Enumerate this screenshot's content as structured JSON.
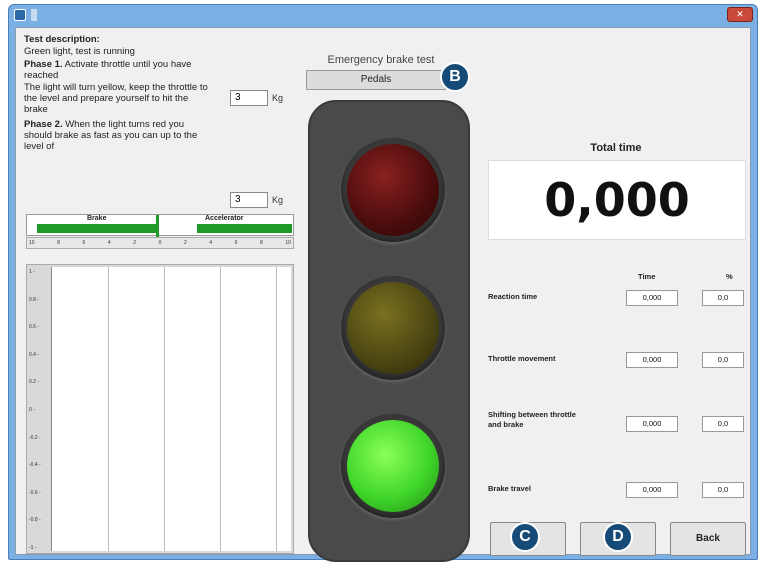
{
  "window": {
    "title": "",
    "close_glyph": "✕"
  },
  "description": {
    "heading": "Test description:",
    "status": "Green light, test is running",
    "phase1_title": "Phase 1.",
    "phase1_text": " Activate throttle until you have reached",
    "phase1_cont": "The light will turn yellow, keep the throttle to the level and prepare yourself to hit the brake",
    "phase1_value": "3",
    "phase2_title": "Phase 2.",
    "phase2_text": " When the light turns red you should brake as fast as you can up to the level of",
    "phase2_value": "3",
    "unit": "Kg"
  },
  "scale": {
    "brake_label": "Brake",
    "accel_label": "Accelerator",
    "brake_level": 0.47,
    "accel_level": 0.37,
    "ticks": [
      "10",
      "8",
      "6",
      "4",
      "2",
      "0",
      "2",
      "4",
      "6",
      "8",
      "10"
    ]
  },
  "chart": {
    "yticks": [
      "1",
      "0.8",
      "0.6",
      "0.4",
      "0.2",
      "0",
      "-0.2",
      "-0.4",
      "-0.6",
      "-0.8",
      "-1"
    ]
  },
  "center": {
    "emergency_label": "Emergency brake test",
    "pedals_button": "Pedals",
    "lights": {
      "red": "off",
      "yellow": "off",
      "green": "on"
    }
  },
  "results": {
    "total_label": "Total time",
    "total_value": "0,000",
    "col_time": "Time",
    "col_percent": "%",
    "rows": [
      {
        "label": "Reaction time",
        "time": "0,000",
        "percent": "0,0"
      },
      {
        "label": "Throttle movement",
        "time": "0,000",
        "percent": "0,0"
      },
      {
        "label": "Shifting between throttle and brake",
        "time": "0,000",
        "percent": "0,0"
      },
      {
        "label": "Brake travel",
        "time": "0,000",
        "percent": "0,0"
      }
    ]
  },
  "buttons": {
    "c_label": "",
    "d_label": "s",
    "back": "Back"
  },
  "badges": {
    "b": "B",
    "c": "C",
    "d": "D"
  },
  "colors": {
    "accent_badge": "#174b77",
    "green_light": "#40d62a",
    "scale_green": "#1f9a2a"
  }
}
